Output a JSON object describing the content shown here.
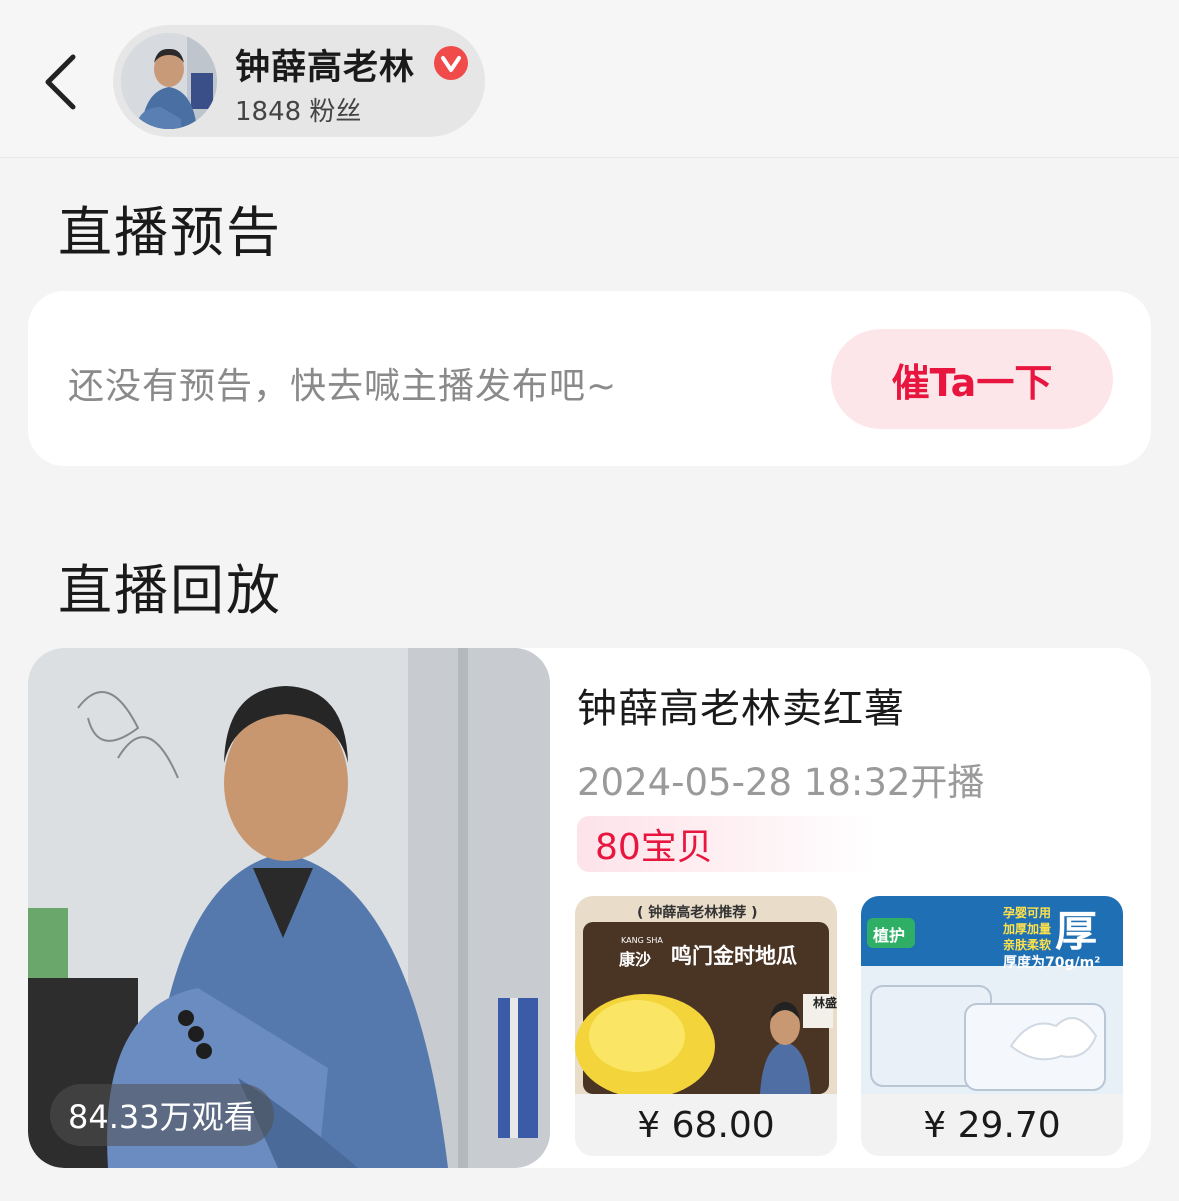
{
  "header": {
    "back_icon": "chevron-left-icon",
    "name": "钟薛高老林",
    "verified_icon": "verified-badge-icon",
    "fans": "1848 粉丝"
  },
  "preview": {
    "title": "直播预告",
    "empty_text": "还没有预告，快去喊主播发布吧~",
    "urge_button": "催Ta一下"
  },
  "replay": {
    "title": "直播回放",
    "card": {
      "views": "84.33万观看",
      "live_title": "钟薛高老林卖红薯",
      "start_time": "2024-05-28 18:32开播",
      "items_count": "80宝贝",
      "products": [
        {
          "price": "¥ 68.00",
          "banner": "( 钟薛高老林推荐 )",
          "brand_en": "KANG SHA",
          "brand": "康沙",
          "name": "鸣门金时地瓜",
          "tag": "林盛"
        },
        {
          "price": "¥ 29.70",
          "brand": "植护",
          "promo_1": "孕婴可用",
          "promo_2": "加厚加量",
          "promo_3": "亲肤柔软",
          "big_char": "厚",
          "spec": "厚度为70g/m²"
        }
      ]
    }
  },
  "colors": {
    "accent": "#e8163f",
    "urge_bg": "#fde6ea",
    "page_bg": "#f4f4f4"
  }
}
